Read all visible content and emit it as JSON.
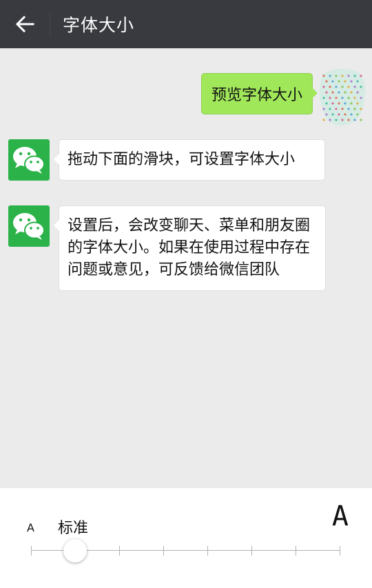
{
  "header": {
    "title": "字体大小",
    "back_icon": "arrow-left-icon"
  },
  "messages": [
    {
      "side": "right",
      "text": "预览字体大小"
    },
    {
      "side": "left",
      "text": "拖动下面的滑块，可设置字体大小"
    },
    {
      "side": "left",
      "text": "设置后，会改变聊天、菜单和朋友圈的字体大小。如果在使用过程中存在问题或意见，可反馈给微信团队"
    }
  ],
  "font_panel": {
    "small_label": "A",
    "current_label": "标准",
    "large_label": "A",
    "slider_position": 1,
    "slider_steps": 7
  },
  "colors": {
    "header_bg": "#393a3f",
    "chat_bg": "#ebebeb",
    "sent_bubble": "#a0e75a",
    "wechat_green": "#2bb34a"
  }
}
